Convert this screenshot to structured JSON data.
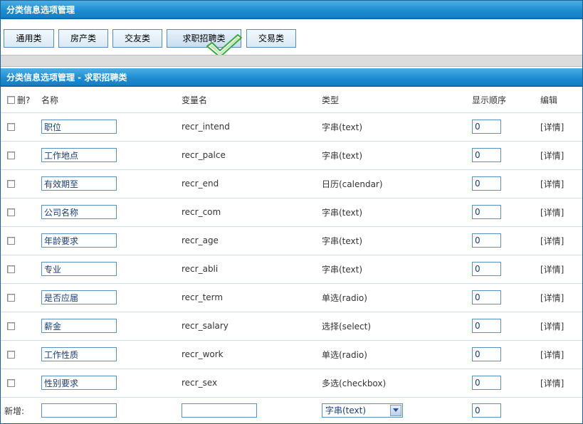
{
  "header": {
    "title": "分类信息选项管理"
  },
  "tabs": [
    {
      "label": "通用类"
    },
    {
      "label": "房产类"
    },
    {
      "label": "交友类"
    },
    {
      "label": "求职招聘类"
    },
    {
      "label": "交易类"
    }
  ],
  "section": {
    "title": "分类信息选项管理 - 求职招聘类"
  },
  "table": {
    "columns": {
      "delete": "删?",
      "name": "名称",
      "variable": "变量名",
      "type": "类型",
      "order": "显示顺序",
      "edit": "编辑"
    },
    "rows": [
      {
        "name": "职位",
        "variable": "recr_intend",
        "type": "字串(text)",
        "order": "0",
        "edit": "[详情]"
      },
      {
        "name": "工作地点",
        "variable": "recr_palce",
        "type": "字串(text)",
        "order": "0",
        "edit": "[详情]"
      },
      {
        "name": "有效期至",
        "variable": "recr_end",
        "type": "日历(calendar)",
        "order": "0",
        "edit": "[详情]"
      },
      {
        "name": "公司名称",
        "variable": "recr_com",
        "type": "字串(text)",
        "order": "0",
        "edit": "[详情]"
      },
      {
        "name": "年龄要求",
        "variable": "recr_age",
        "type": "字串(text)",
        "order": "0",
        "edit": "[详情]"
      },
      {
        "name": "专业",
        "variable": "recr_abli",
        "type": "字串(text)",
        "order": "0",
        "edit": "[详情]"
      },
      {
        "name": "是否应届",
        "variable": "recr_term",
        "type": "单选(radio)",
        "order": "0",
        "edit": "[详情]"
      },
      {
        "name": "薪金",
        "variable": "recr_salary",
        "type": "选择(select)",
        "order": "0",
        "edit": "[详情]"
      },
      {
        "name": "工作性质",
        "variable": "recr_work",
        "type": "单选(radio)",
        "order": "0",
        "edit": "[详情]"
      },
      {
        "name": "性别要求",
        "variable": "recr_sex",
        "type": "多选(checkbox)",
        "order": "0",
        "edit": "[详情]"
      }
    ]
  },
  "new_row": {
    "label": "新增:",
    "name_value": "",
    "variable_value": "",
    "type_selected": "字串(text)",
    "order_value": "0"
  },
  "colors": {
    "titlebar": "#1d8bd0",
    "border": "#5b8fbd",
    "row_divider": "#c5dcef",
    "input_text": "#1a3d73",
    "check_accent": "#3aa83a"
  },
  "icons": {
    "active_tab_marker": "checkmark-icon",
    "select_arrow": "chevron-down-icon"
  }
}
